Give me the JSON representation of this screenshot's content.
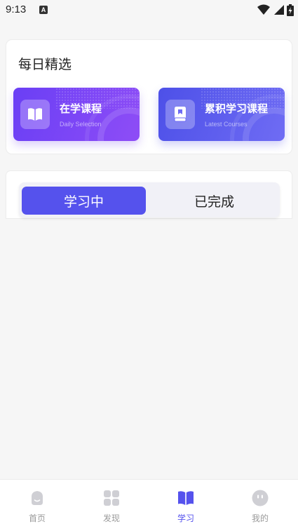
{
  "status_bar": {
    "time": "9:13",
    "notification_icon": "a-badge-icon",
    "icons": [
      "wifi-icon",
      "signal-icon",
      "battery-charging-icon"
    ]
  },
  "daily": {
    "title": "每日精选",
    "cards": [
      {
        "title": "在学课程",
        "subtitle": "Daily Selection",
        "icon": "open-book-icon"
      },
      {
        "title": "累积学习课程",
        "subtitle": "Latest Courses",
        "icon": "closed-book-icon"
      }
    ]
  },
  "tabs": [
    {
      "label": "学习中",
      "active": true
    },
    {
      "label": "已完成",
      "active": false
    }
  ],
  "bottom_nav": [
    {
      "label": "首页",
      "icon": "home-blob-icon",
      "active": false
    },
    {
      "label": "发现",
      "icon": "grid-icon",
      "active": false
    },
    {
      "label": "学习",
      "icon": "book-icon",
      "active": true
    },
    {
      "label": "我的",
      "icon": "profile-face-icon",
      "active": false
    }
  ],
  "colors": {
    "accent": "#5552ed",
    "card_left_gradient": [
      "#6a3ff5",
      "#8e4df6"
    ],
    "card_right_gradient": [
      "#4d50e8",
      "#6f6cf4"
    ],
    "inactive_nav": "#9a9a9a"
  }
}
